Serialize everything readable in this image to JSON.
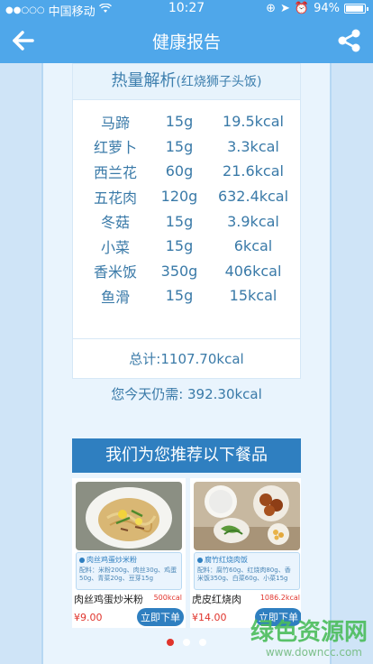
{
  "status_bar": {
    "carrier": "中国移动",
    "time": "10:27",
    "battery": "94%",
    "battery_level": 0.94
  },
  "header": {
    "title": "健康报告",
    "back_icon": "arrow-left-icon",
    "share_icon": "share-icon"
  },
  "analysis": {
    "title": "热量解析",
    "subtitle": "(红烧狮子头饭)",
    "items": [
      {
        "name": "马蹄",
        "weight": "15g",
        "kcal": "19.5kcal"
      },
      {
        "name": "红萝卜",
        "weight": "15g",
        "kcal": "3.3kcal"
      },
      {
        "name": "西兰花",
        "weight": "60g",
        "kcal": "21.6kcal"
      },
      {
        "name": "五花肉",
        "weight": "120g",
        "kcal": "632.4kcal"
      },
      {
        "name": "冬菇",
        "weight": "15g",
        "kcal": "3.9kcal"
      },
      {
        "name": "小菜",
        "weight": "15g",
        "kcal": "6kcal"
      },
      {
        "name": "香米饭",
        "weight": "350g",
        "kcal": "406kcal"
      },
      {
        "name": "鱼滑",
        "weight": "15g",
        "kcal": "15kcal"
      }
    ],
    "total": "总计:1107.70kcal"
  },
  "remaining": "您今天仍需:  392.30kcal",
  "recommend": {
    "title": "我们为您推荐以下餐品",
    "items": [
      {
        "tag": "肉丝鸡蛋炒米粉",
        "ingredients": "配料：米粉200g、肉丝30g、鸡蛋50g、青菜20g、豆芽15g",
        "name": "肉丝鸡蛋炒米粉",
        "kcal": "500kcal",
        "price": "¥9.00",
        "button": "立即下单"
      },
      {
        "tag": "腐竹红烧肉饭",
        "ingredients": "配料：腐竹60g、红烧肉80g、香米饭350g、白菜60g、小菜15g",
        "name": "虎皮红烧肉",
        "kcal": "1086.2kcal",
        "price": "¥14.00",
        "button": "立即下单"
      }
    ]
  },
  "pager": {
    "count": 3,
    "active": 1
  },
  "watermark": {
    "text": "绿色资源网",
    "url": "www.downcc.com"
  },
  "colors": {
    "primary": "#4fa7ea",
    "dark_blue": "#2f7fc0",
    "text_blue": "#3a7aa8",
    "price_red": "#e0342c"
  }
}
